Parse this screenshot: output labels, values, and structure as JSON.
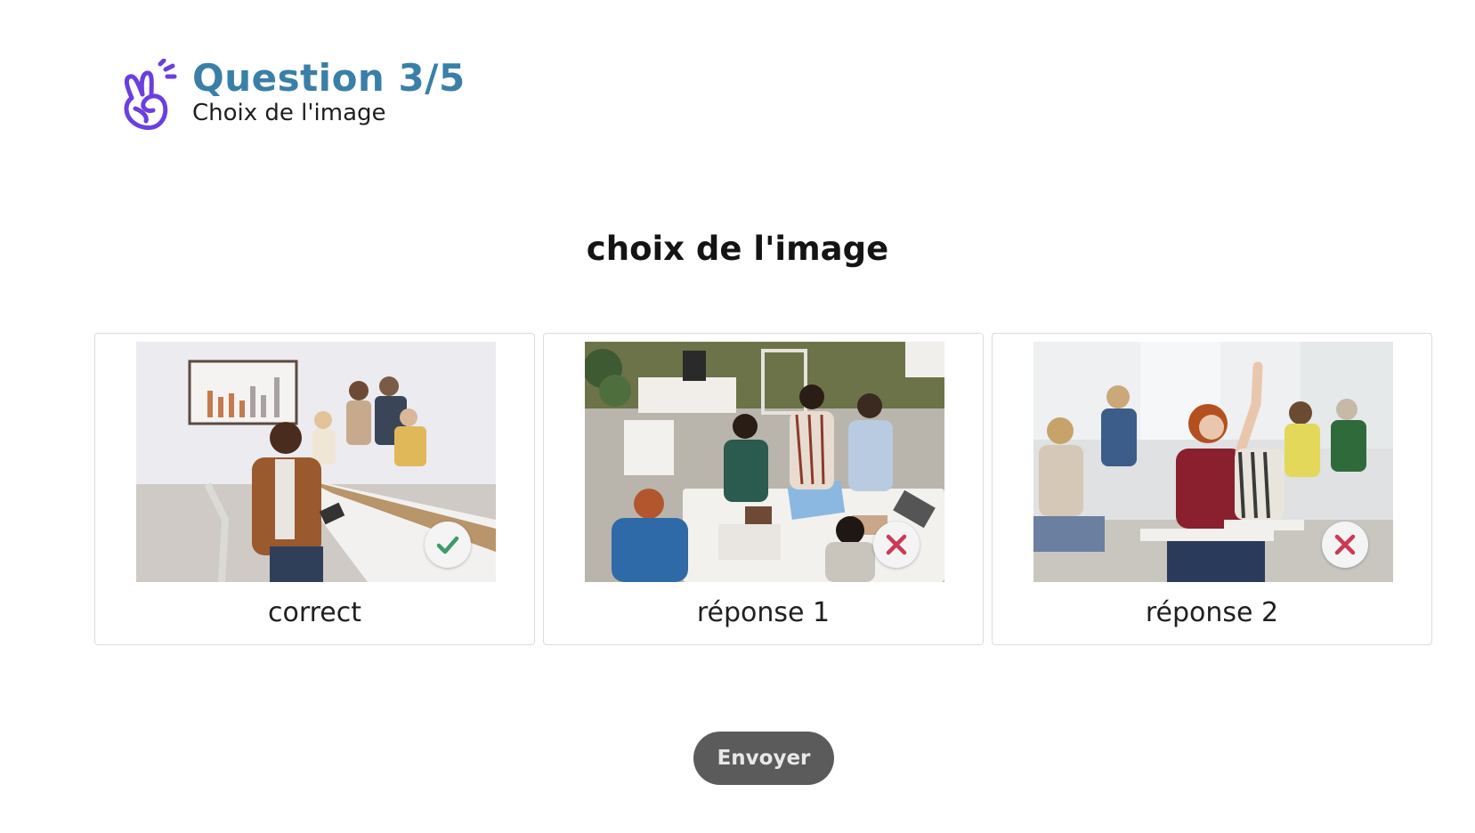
{
  "header": {
    "title": "Question 3/5",
    "subtitle": "Choix de l'image",
    "brand_color": "#3a7fa8",
    "logo_color": "#6a3fe0"
  },
  "question": {
    "text": "choix de l'image"
  },
  "choices": [
    {
      "label": "correct",
      "status": "correct",
      "status_icon": "check-icon",
      "status_color": "#3f9a6a"
    },
    {
      "label": "réponse 1",
      "status": "incorrect",
      "status_icon": "cross-icon",
      "status_color": "#c93a55"
    },
    {
      "label": "réponse 2",
      "status": "incorrect",
      "status_icon": "cross-icon",
      "status_color": "#c93a55"
    }
  ],
  "submit": {
    "label": "Envoyer",
    "state": "disabled"
  }
}
